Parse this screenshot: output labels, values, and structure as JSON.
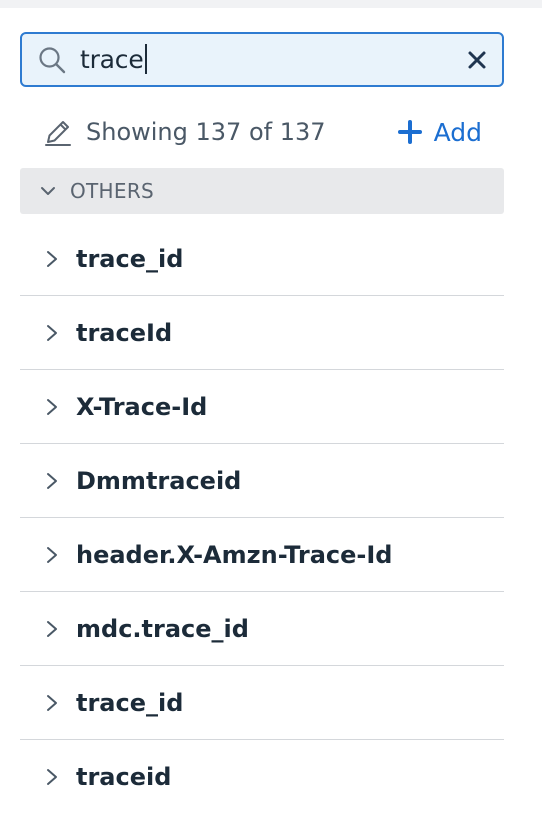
{
  "search": {
    "value": "trace",
    "icon": "search-icon",
    "clear_icon": "close-icon"
  },
  "status": {
    "showing_text": "Showing 137 of 137",
    "edit_icon": "pencil-icon",
    "add_label": "Add",
    "add_icon": "plus-icon"
  },
  "section": {
    "label": "OTHERS",
    "icon": "chevron-down-icon"
  },
  "items": [
    {
      "label": "trace_id"
    },
    {
      "label": "traceId"
    },
    {
      "label": "X-Trace-Id"
    },
    {
      "label": "Dmmtraceid"
    },
    {
      "label": "header.X-Amzn-Trace-Id"
    },
    {
      "label": "mdc.trace_id"
    },
    {
      "label": "trace_id"
    },
    {
      "label": "traceid"
    }
  ],
  "colors": {
    "accent": "#2e7bd1",
    "link": "#1b6ed1",
    "search_bg": "#e9f3fb",
    "section_bg": "#e8e9eb"
  }
}
